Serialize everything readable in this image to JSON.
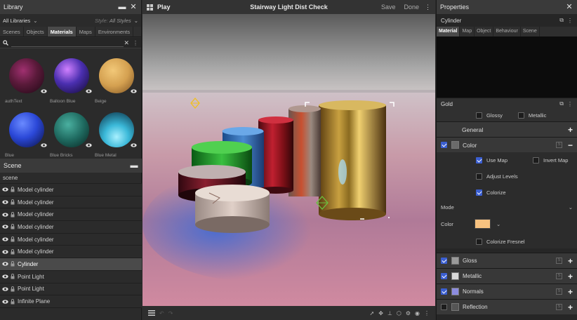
{
  "library": {
    "title": "Library",
    "filter": "All Libraries",
    "style_label": "Style:",
    "style_value": "All Styles",
    "tabs": [
      "Scenes",
      "Objects",
      "Materials",
      "Maps",
      "Environments"
    ],
    "active_tab": "Materials",
    "materials": [
      {
        "name": "authText",
        "color": "#5a1a3a"
      },
      {
        "name": "Balloon Blue",
        "color": "#4b2fb0"
      },
      {
        "name": "Beige",
        "color": "#d4a050"
      },
      {
        "name": "Blue",
        "color": "#2b48d8"
      },
      {
        "name": "Blue Bricks",
        "color": "#1f6a60"
      },
      {
        "name": "Blue Metal",
        "color": "#3ab8d8"
      }
    ]
  },
  "scene": {
    "title": "Scene",
    "root": "scene",
    "items": [
      {
        "label": "Model cylinder",
        "selected": false
      },
      {
        "label": "Model cylinder",
        "selected": false
      },
      {
        "label": "Model cylinder",
        "selected": false
      },
      {
        "label": "Model cylinder",
        "selected": false
      },
      {
        "label": "Model cylinder",
        "selected": false
      },
      {
        "label": "Model cylinder",
        "selected": false
      },
      {
        "label": "Cylinder",
        "selected": true
      },
      {
        "label": "Point Light",
        "selected": false
      },
      {
        "label": "Point Light",
        "selected": false
      },
      {
        "label": "Infinite Plane",
        "selected": false
      }
    ]
  },
  "viewport": {
    "play_label": "Play",
    "title": "Stairway Light Dist Check",
    "save_label": "Save",
    "done_label": "Done"
  },
  "properties": {
    "title": "Properties",
    "object_name": "Cylinder",
    "tabs": [
      "Material",
      "Map",
      "Object",
      "Behaviour",
      "Scene"
    ],
    "active_tab": "Material",
    "material_name": "Gold",
    "glossy_label": "Glossy",
    "metallic_label": "Metallic",
    "general_label": "General",
    "color_section": "Color",
    "use_map_label": "Use Map",
    "invert_map_label": "Invert Map",
    "adjust_levels_label": "Adjust Levels",
    "colorize_label": "Colorize",
    "mode_label": "Mode",
    "color_label": "Color",
    "color_value": "#f7c280",
    "colorize_fresnel_label": "Colorize Fresnel",
    "channels": [
      {
        "label": "Gloss",
        "swatch": "#9a9a9a",
        "checked": true
      },
      {
        "label": "Metallic",
        "swatch": "#d8d8d8",
        "checked": true
      },
      {
        "label": "Normals",
        "swatch": "#8c8ce0",
        "checked": true
      },
      {
        "label": "Reflection",
        "swatch": "#555555",
        "checked": false
      }
    ]
  },
  "colors": {
    "accent": "#3b5fd1",
    "panel": "#2b2b2b",
    "header": "#3a3a3a"
  }
}
